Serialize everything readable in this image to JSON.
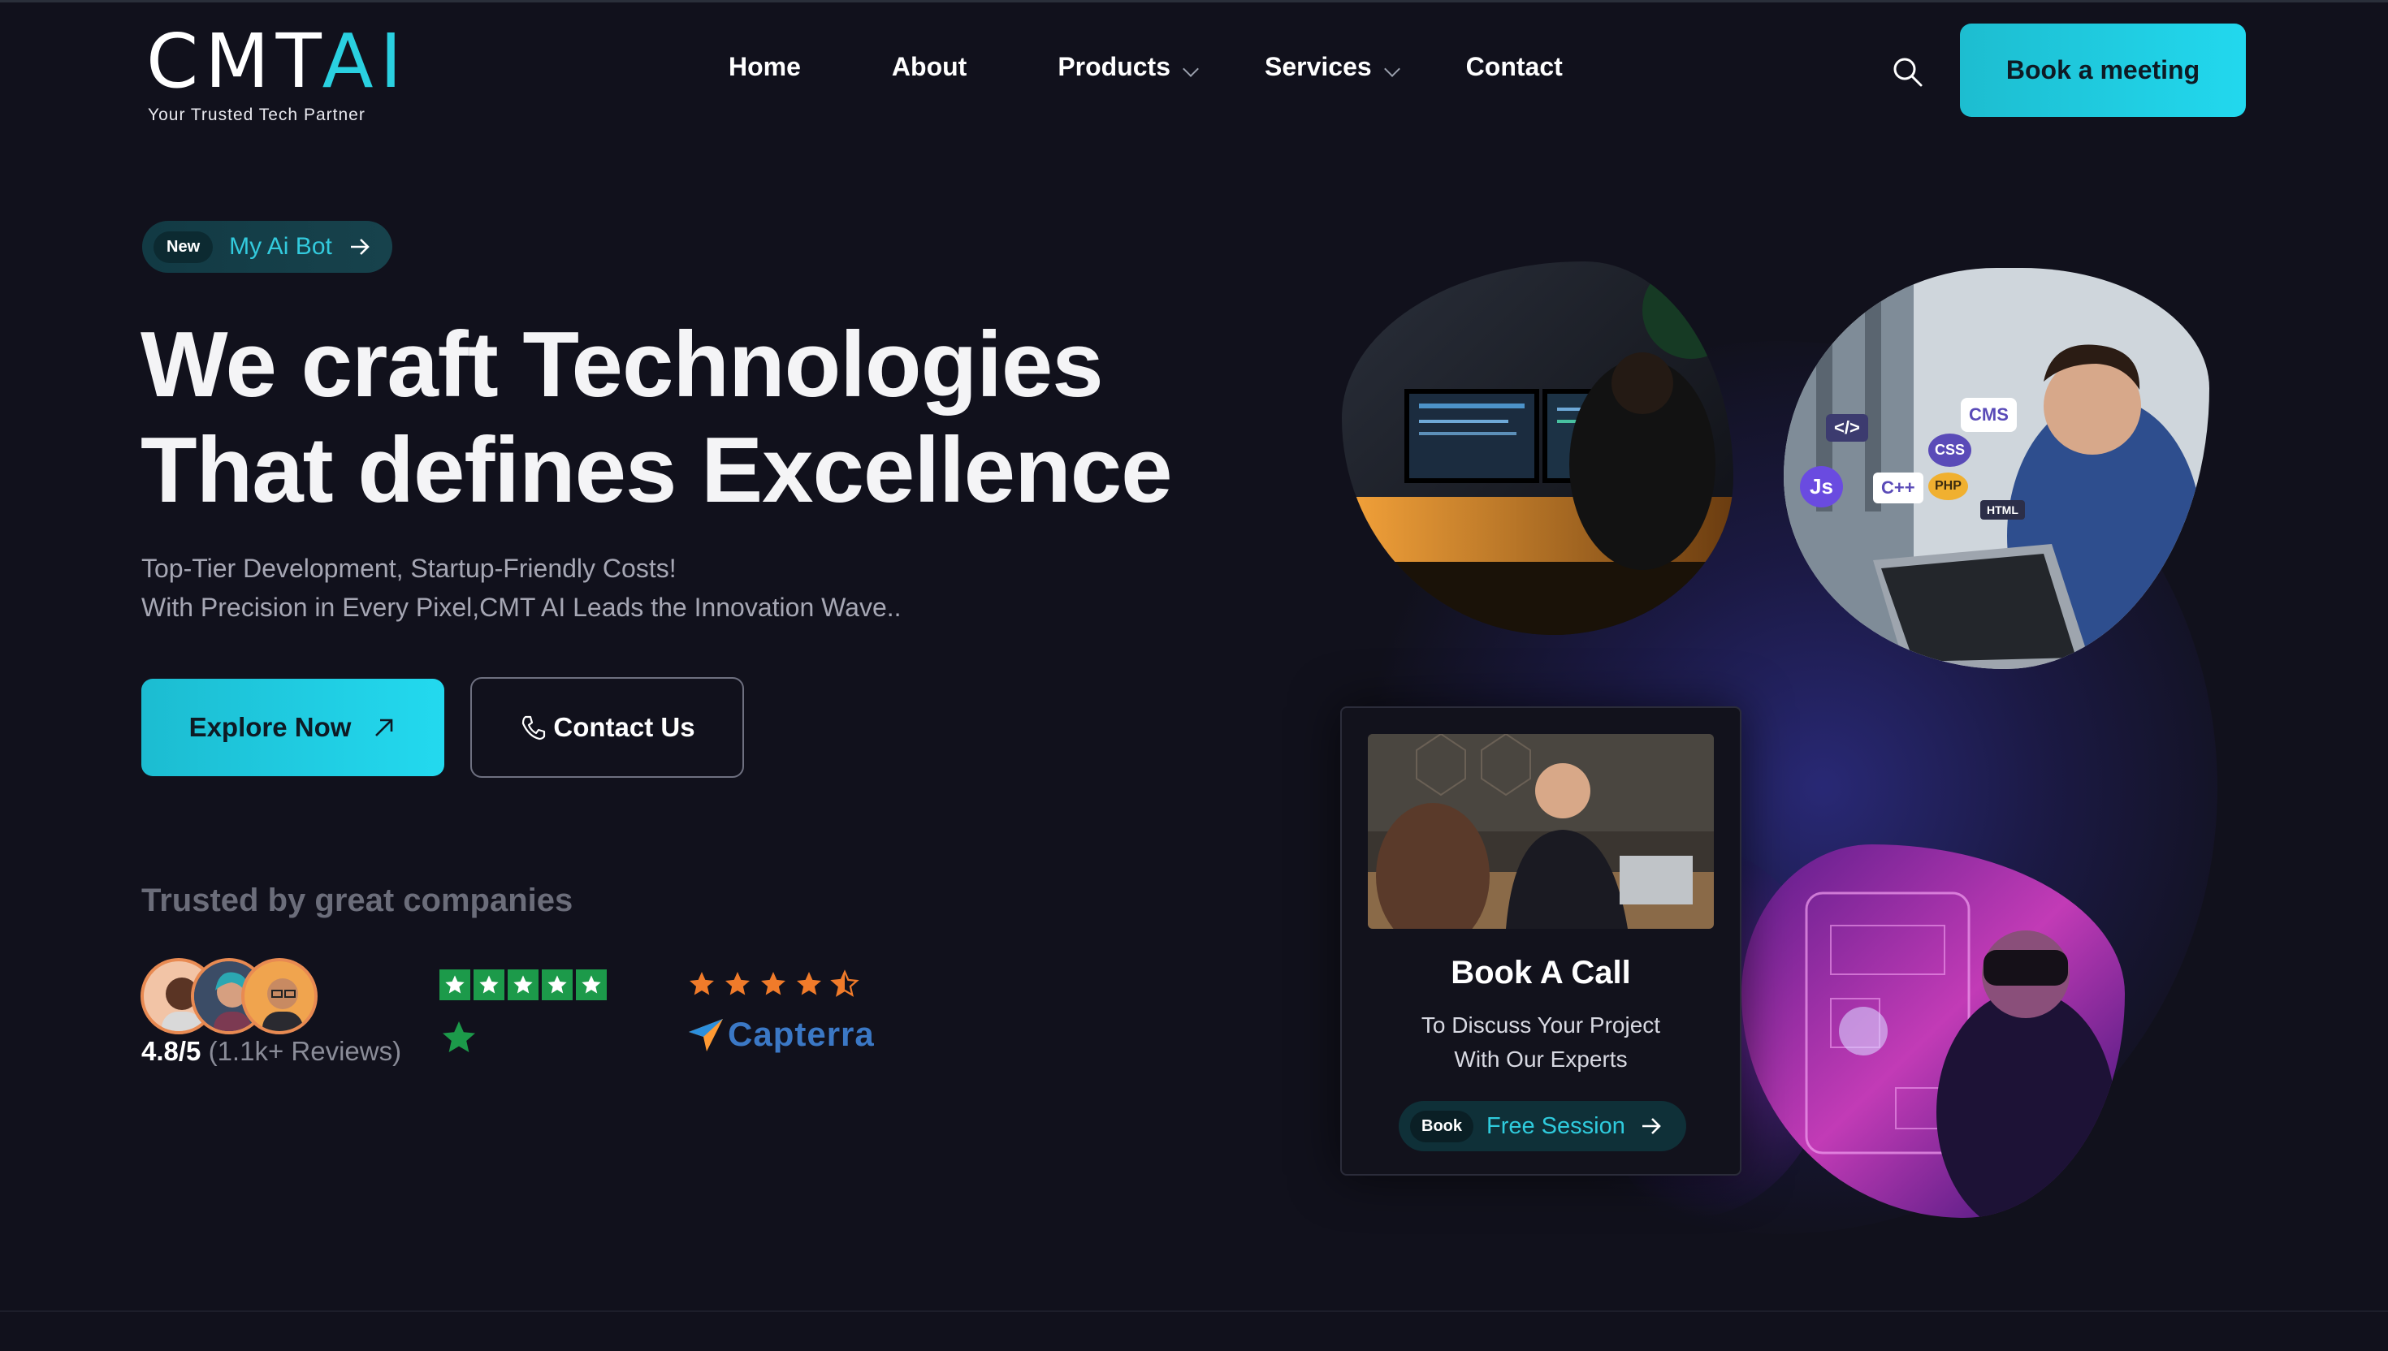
{
  "brand": {
    "logo_main": "CMT",
    "logo_accent": "AI",
    "tagline": "Your Trusted Tech Partner"
  },
  "nav": {
    "items": [
      {
        "label": "Home"
      },
      {
        "label": "About"
      },
      {
        "label": "Products"
      },
      {
        "label": "Services"
      },
      {
        "label": "Contact"
      }
    ],
    "cta": "Book a meeting"
  },
  "hero": {
    "badge_tag": "New",
    "badge_label": "My Ai Bot",
    "headline_line1": "We craft Technologies",
    "headline_line2": "That defines Excellence",
    "sub_line1": "Top-Tier Development, Startup-Friendly Costs!",
    "sub_line2": "With Precision in Every Pixel,CMT AI Leads the Innovation Wave..",
    "primary_button": "Explore Now",
    "secondary_button": "Contact Us"
  },
  "trust": {
    "heading": "Trusted by great companies",
    "rating_score": "4.8/5",
    "rating_reviews": "(1.1k+ Reviews)",
    "trustpilot_stars": 5,
    "capterra_stars": 4.5,
    "capterra_name": "Capterra"
  },
  "book_card": {
    "title": "Book A Call",
    "desc_line1": "To Discuss Your Project",
    "desc_line2": "With Our Experts",
    "tag": "Book",
    "label": "Free Session"
  },
  "badges": {
    "code_tags": [
      "</>",
      "CSS",
      "CMS",
      "Js",
      "C++",
      "PHP",
      "HTML"
    ]
  },
  "colors": {
    "background": "#11111c",
    "accent": "#22d8ee",
    "trustpilot": "#1c9a4a",
    "capterra_star": "#f07b2a"
  }
}
